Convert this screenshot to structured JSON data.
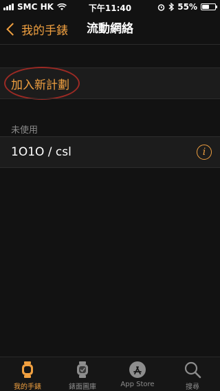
{
  "status": {
    "carrier": "SMC HK",
    "time": "下午11:40",
    "battery": "55%",
    "battery_level": 0.55
  },
  "nav": {
    "back_label": "我的手錶",
    "title": "流動網絡"
  },
  "actions": {
    "add_plan": "加入新計劃"
  },
  "section": {
    "header": "未使用",
    "plan": "1O1O / csl",
    "info_glyph": "i"
  },
  "tabs": [
    {
      "label": "我的手錶",
      "icon": "watch-icon",
      "active": true
    },
    {
      "label": "錶面圖庫",
      "icon": "watch-face-gallery-icon",
      "active": false
    },
    {
      "label": "App Store",
      "icon": "app-store-icon",
      "active": false
    },
    {
      "label": "搜尋",
      "icon": "search-icon",
      "active": false
    }
  ],
  "colors": {
    "accent": "#f0a040",
    "background": "#121212",
    "annotation_circle": "#9c2a24"
  }
}
